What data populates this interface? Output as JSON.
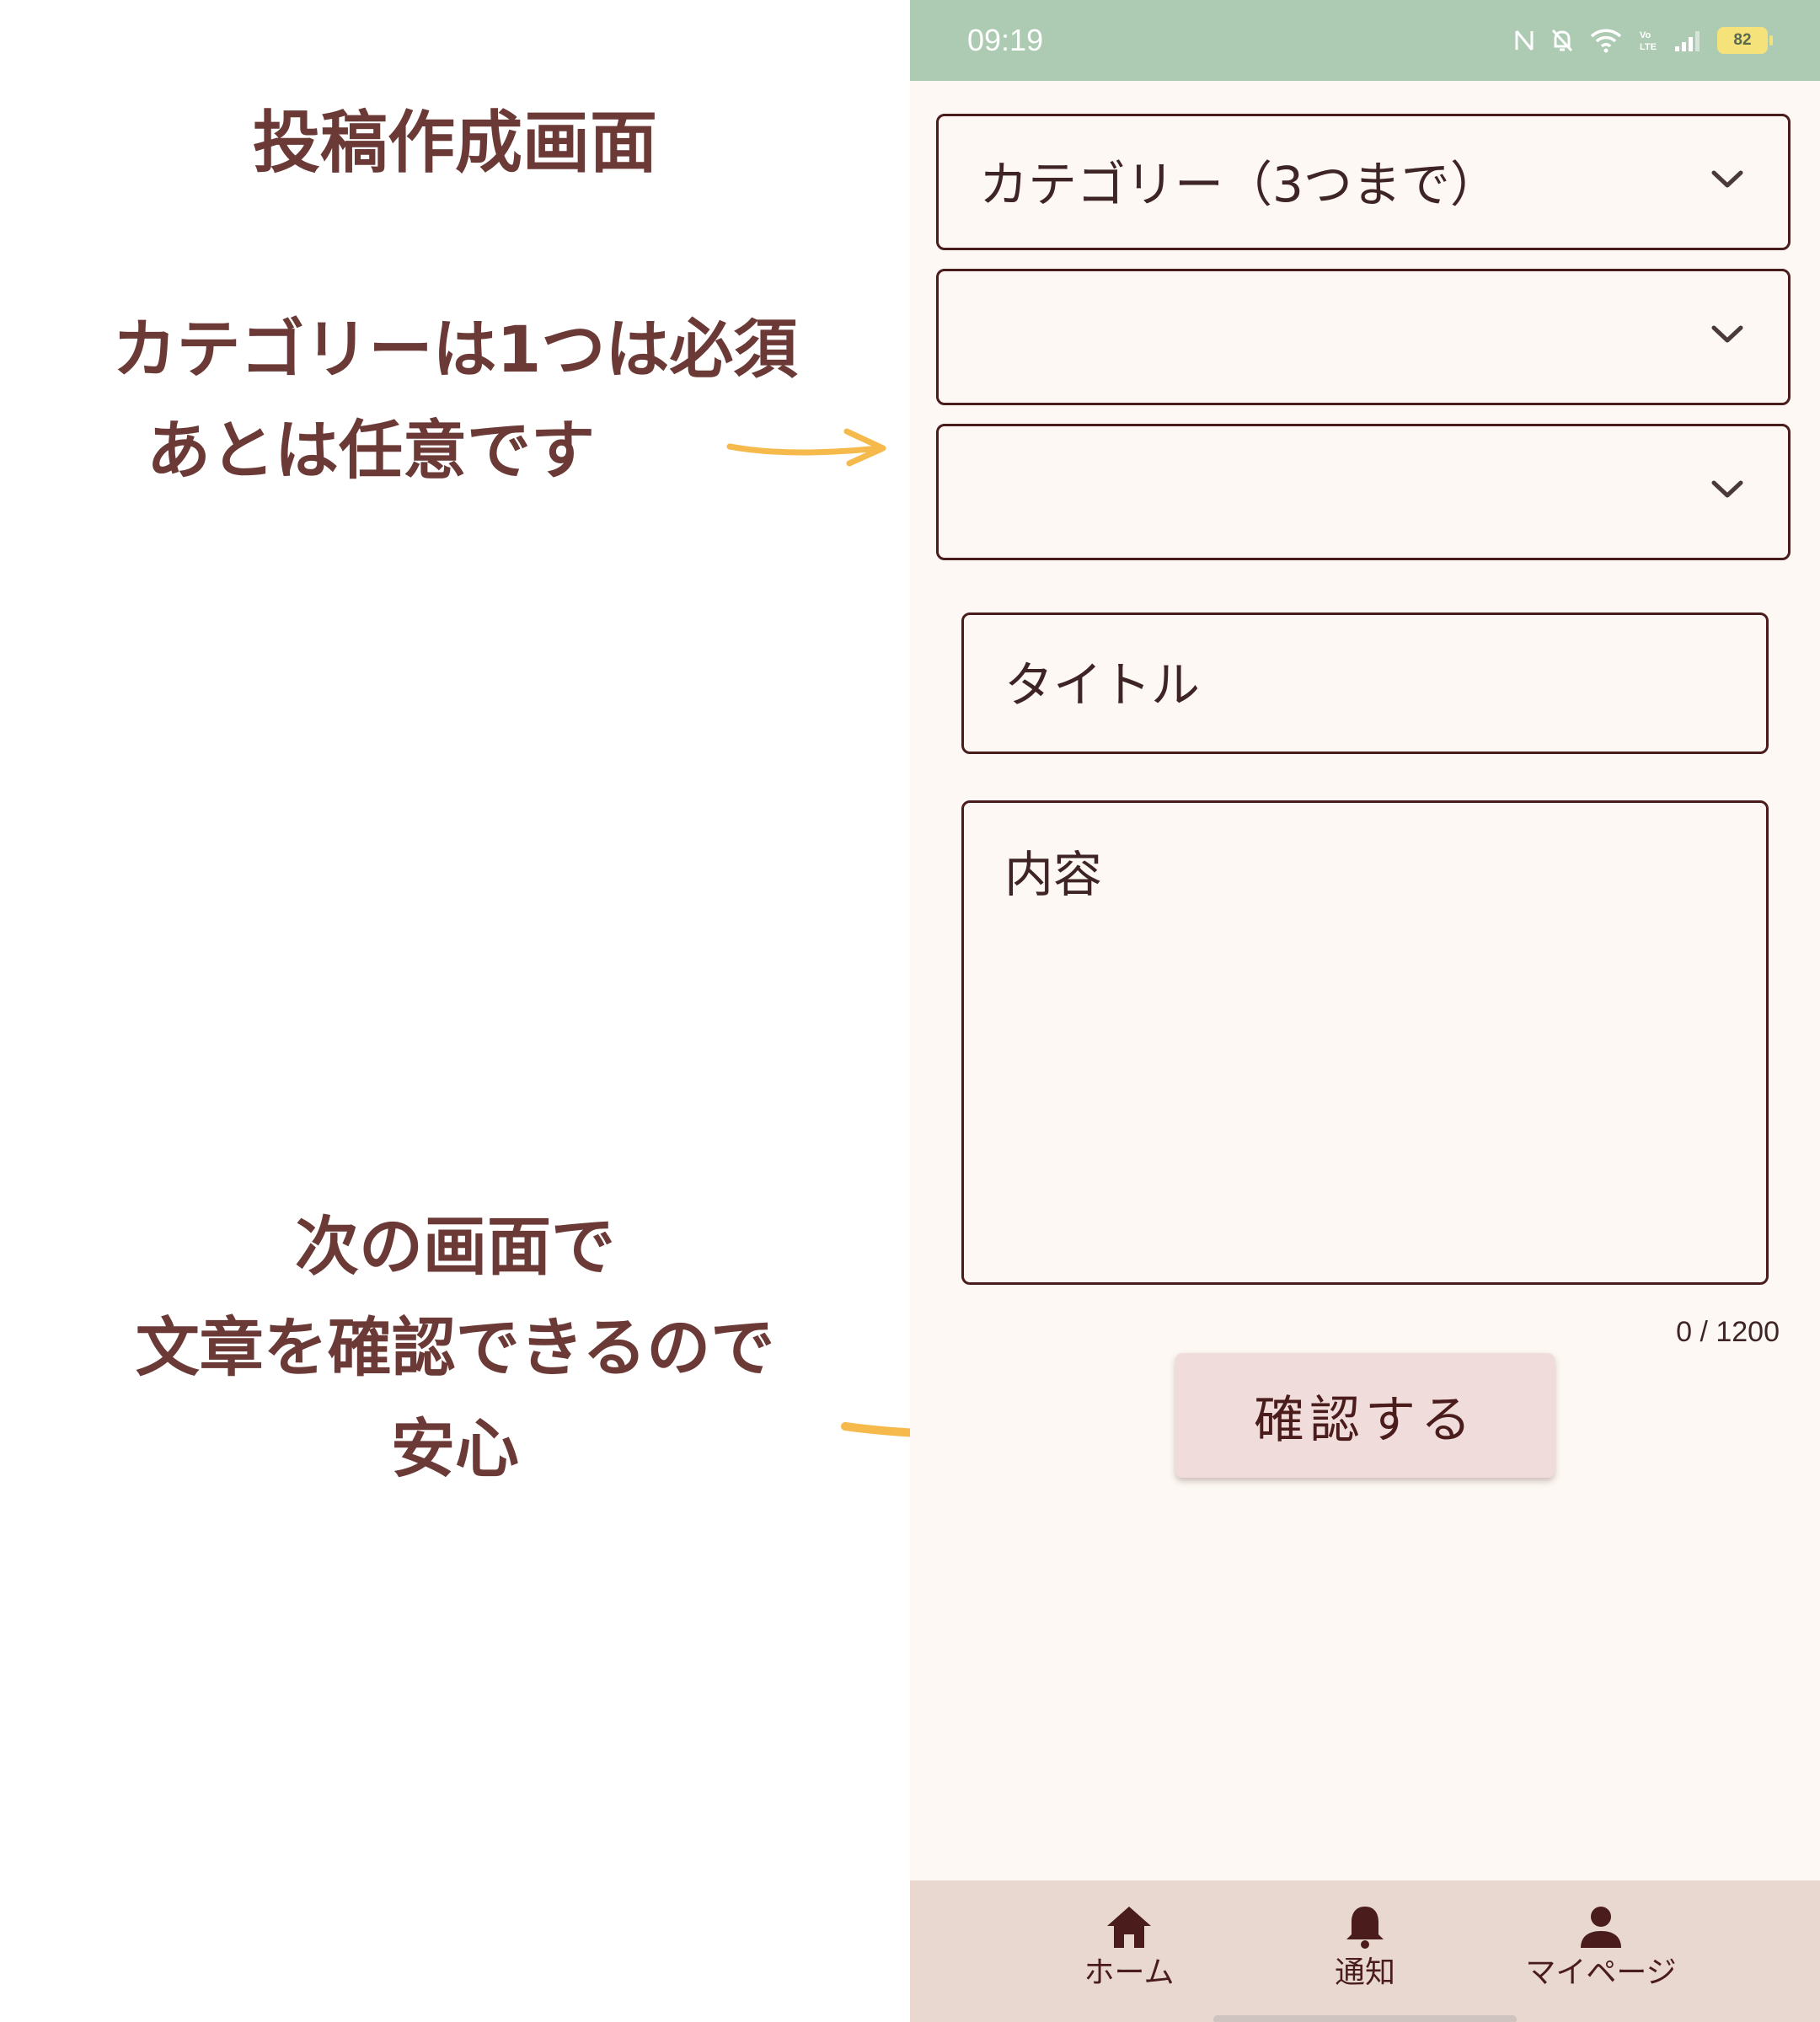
{
  "annotations": {
    "title": "投稿作成画面",
    "category_note": [
      "カテゴリーは1つは必須",
      "あとは任意です"
    ],
    "confirm_note": [
      "次の画面で",
      "文章を確認できるので",
      "安心"
    ]
  },
  "status_bar": {
    "time": "09:19",
    "battery": "82",
    "icons": [
      "nfc-icon",
      "bell-off-icon",
      "wifi-icon",
      "volte-icon",
      "signal-icon",
      "battery-icon"
    ]
  },
  "form": {
    "category_label": "カテゴリー（3つまで）",
    "category_2": "",
    "category_3": "",
    "title_placeholder": "タイトル",
    "content_placeholder": "内容",
    "char_counter": "0 / 1200",
    "confirm_button": "確認する"
  },
  "bottom_nav": {
    "items": [
      {
        "label": "ホーム",
        "icon": "home-icon"
      },
      {
        "label": "通知",
        "icon": "bell-icon"
      },
      {
        "label": "マイページ",
        "icon": "person-icon"
      }
    ]
  },
  "colors": {
    "status_bar": "#adcbb2",
    "background": "#fdf8f3",
    "border": "#4a1c1c",
    "button": "#f1dcdc",
    "bottom_nav": "#e8d8d0",
    "annotation_text": "#6b3a36",
    "arrow": "#f5b94c"
  }
}
